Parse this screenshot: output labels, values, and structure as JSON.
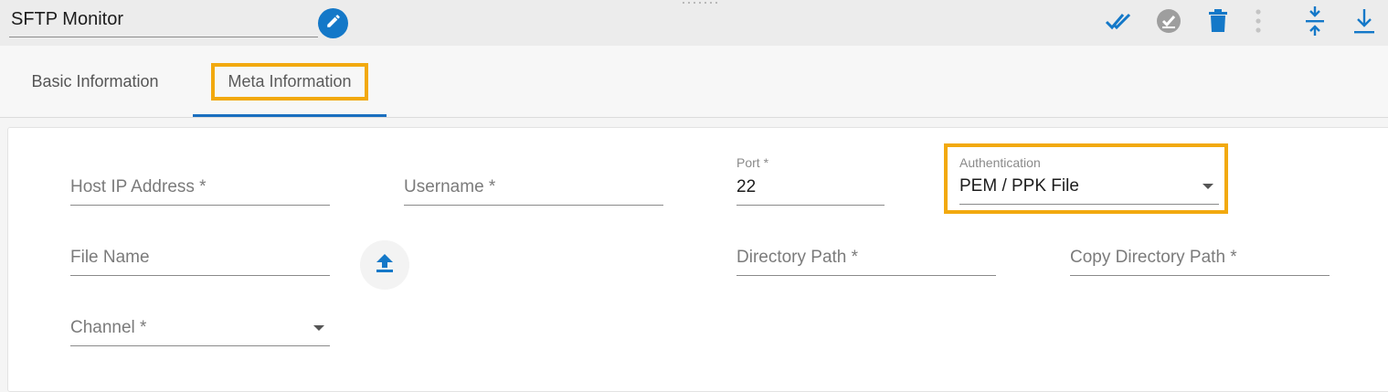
{
  "header": {
    "title": "SFTP Monitor",
    "accent_color": "#1478c8",
    "icons": {
      "edit": "pencil-icon",
      "validate": "double-check-icon",
      "activate": "check-circle-icon",
      "delete": "trash-icon",
      "more": "more-vertical-icon",
      "collapse": "collapse-vertical-icon",
      "download": "download-icon"
    }
  },
  "tabs": [
    {
      "label": "Basic Information",
      "active": false
    },
    {
      "label": "Meta Information",
      "active": true,
      "highlighted": true
    }
  ],
  "form": {
    "host_ip": {
      "placeholder": "Host IP Address *",
      "value": ""
    },
    "username": {
      "placeholder": "Username *",
      "value": ""
    },
    "port": {
      "label": "Port *",
      "value": "22"
    },
    "authentication": {
      "label": "Authentication",
      "value": "PEM / PPK File",
      "highlighted": true
    },
    "file_name": {
      "placeholder": "File Name",
      "value": ""
    },
    "upload_icon": "upload-icon",
    "directory_path": {
      "placeholder": "Directory Path *",
      "value": ""
    },
    "copy_directory_path": {
      "placeholder": "Copy Directory Path *",
      "value": ""
    },
    "channel": {
      "placeholder": "Channel *",
      "value": ""
    }
  },
  "colors": {
    "highlight": "#f2a90f",
    "tab_underline": "#1a6fbf",
    "icon_blue": "#1478c8",
    "icon_grey": "#9e9e9e"
  }
}
